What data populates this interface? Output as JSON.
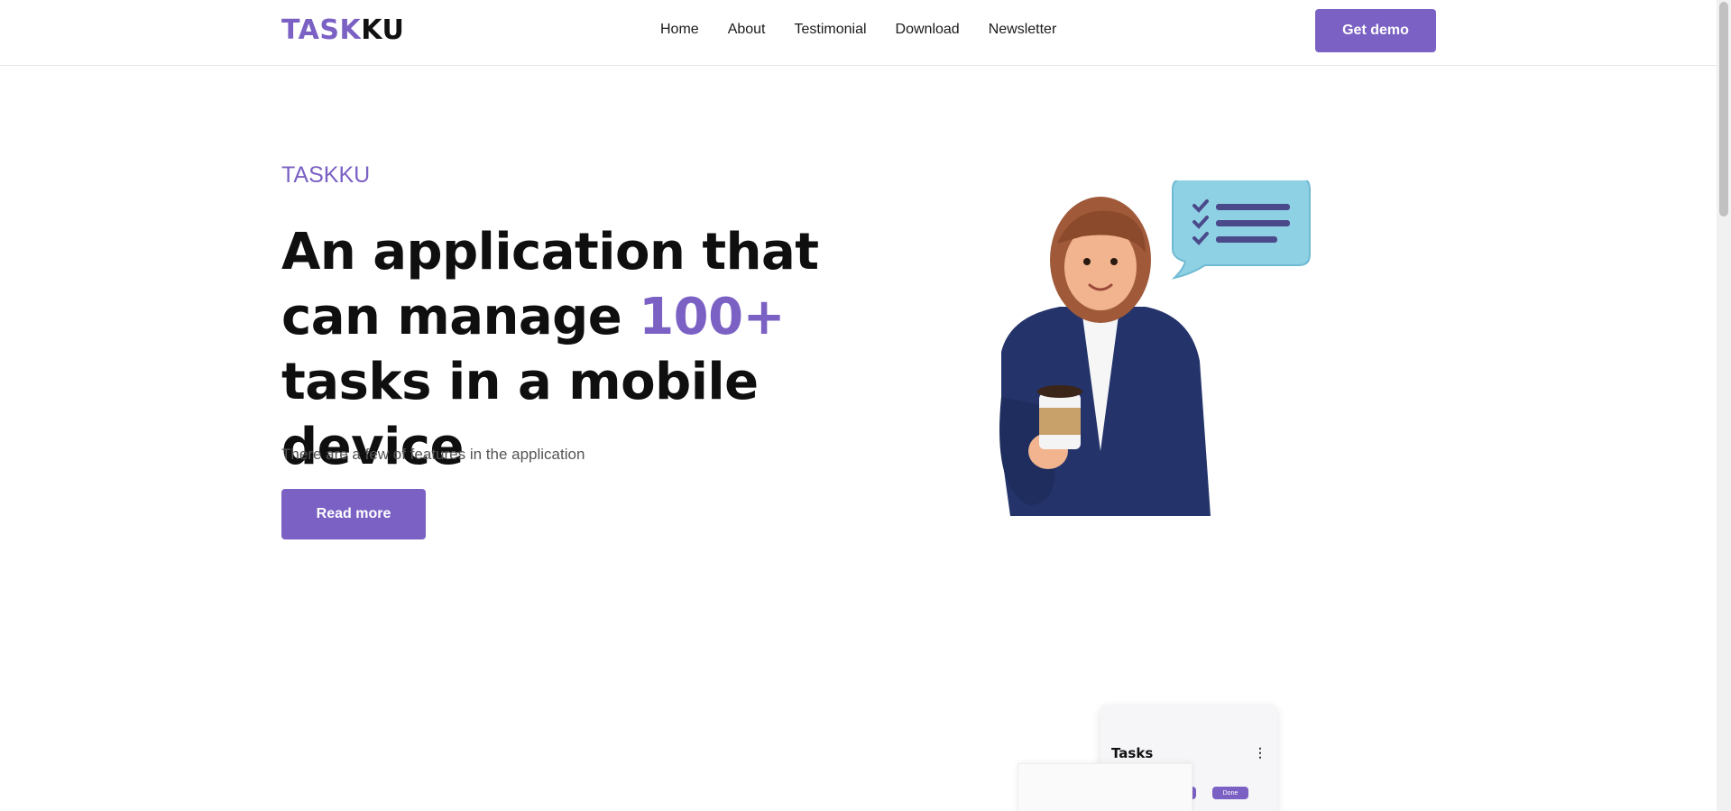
{
  "header": {
    "logo_part1": "TASK",
    "logo_part2": "KU",
    "nav": [
      "Home",
      "About",
      "Testimonial",
      "Download",
      "Newsletter"
    ],
    "cta_label": "Get demo"
  },
  "hero": {
    "eyebrow": "TASKKU",
    "headline_before": "An application that can manage ",
    "headline_accent": "100+",
    "headline_after": " tasks in a mobile device",
    "subtext": "There are a few of features in the application",
    "button_label": "Read more"
  },
  "preview": {
    "title": "Tasks",
    "menu_icon": "more-vertical-icon",
    "pill_labels": [
      "Done",
      "Done"
    ]
  },
  "colors": {
    "accent": "#7b61c4",
    "text": "#111111",
    "muted": "#555555"
  }
}
